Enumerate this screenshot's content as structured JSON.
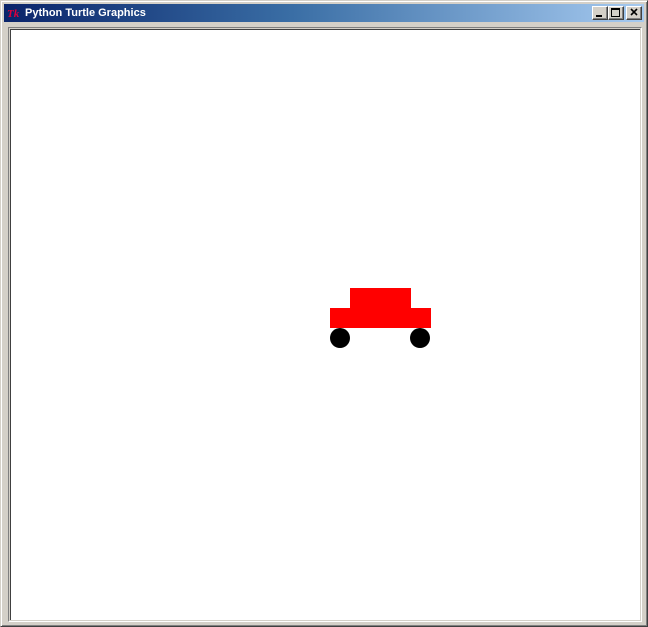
{
  "window": {
    "title": "Python Turtle Graphics",
    "icon": "tk-feather-icon",
    "buttons": [
      "minimize-icon",
      "maximize-icon",
      "close-icon"
    ]
  },
  "drawing": {
    "background": "#ffffff",
    "car_body_color": "#ff0000",
    "wheel_color": "#000000"
  }
}
